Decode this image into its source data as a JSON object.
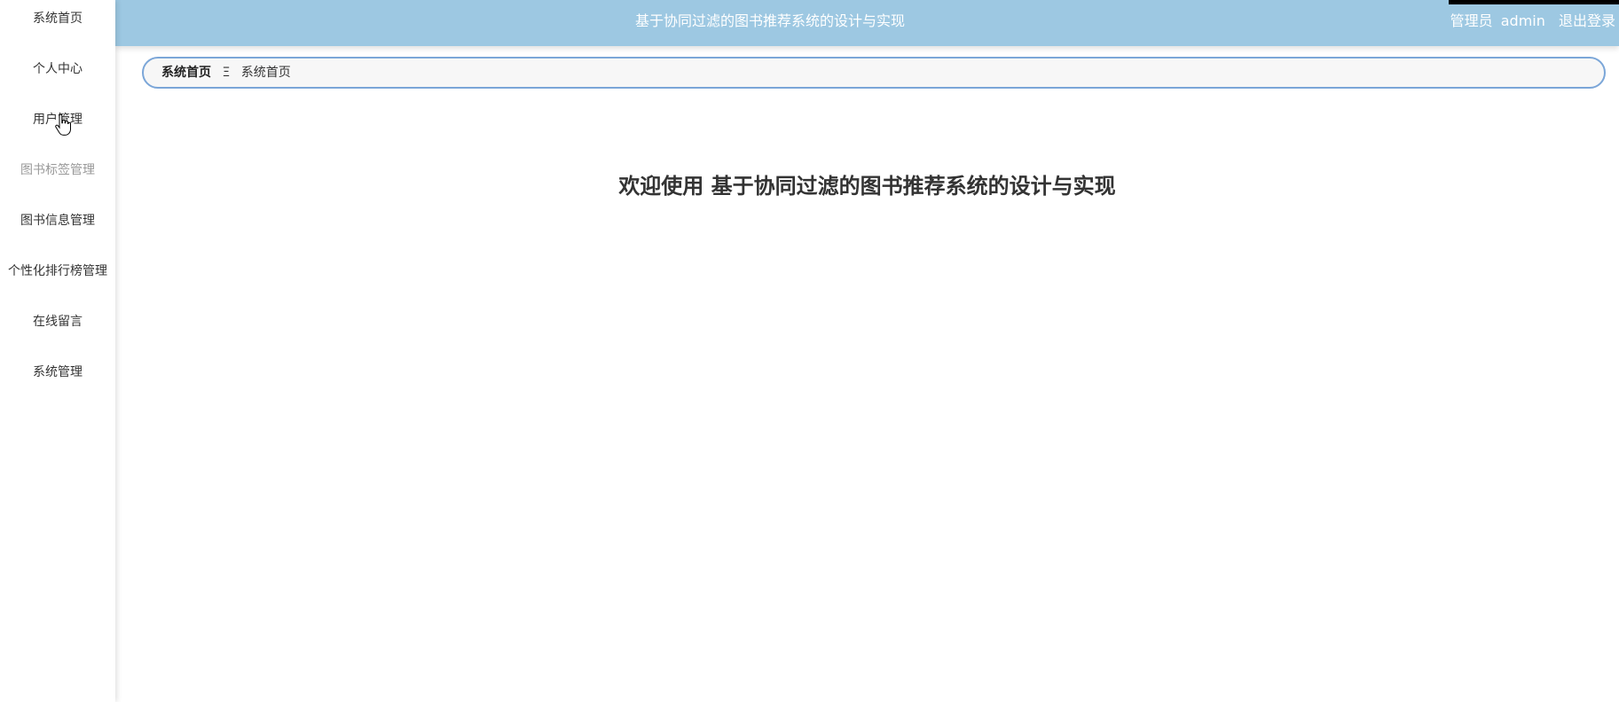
{
  "header": {
    "title": "基于协同过滤的图书推荐系统的设计与实现",
    "role": "管理员",
    "username": "admin",
    "logout_label": "退出登录"
  },
  "sidebar": {
    "items": [
      {
        "label": "系统首页"
      },
      {
        "label": "个人中心"
      },
      {
        "label": "用户管理"
      },
      {
        "label": "图书标签管理"
      },
      {
        "label": "图书信息管理"
      },
      {
        "label": "个性化排行榜管理"
      },
      {
        "label": "在线留言"
      },
      {
        "label": "系统管理"
      }
    ]
  },
  "breadcrumb": {
    "home": "系统首页",
    "separator": "Ξ",
    "current": "系统首页"
  },
  "main": {
    "welcome": "欢迎使用 基于协同过滤的图书推荐系统的设计与实现"
  },
  "colors": {
    "header_bg": "#9dc8e2",
    "breadcrumb_border": "#7ba6d8"
  }
}
